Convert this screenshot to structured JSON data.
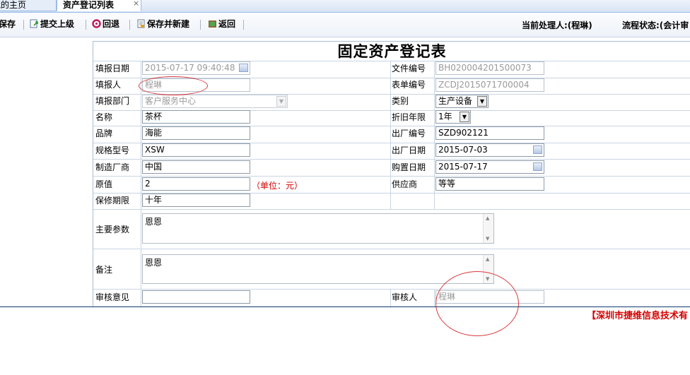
{
  "tabs": [
    {
      "label": "我的主页"
    },
    {
      "label": "资产登记列表",
      "close": "×"
    }
  ],
  "toolbar": {
    "save": "保存",
    "submit": "提交上级",
    "back": "回退",
    "save_new": "保存并新建",
    "return": "返回",
    "handler": "当前处理人:(程琳)",
    "status": "流程状态:(会计审"
  },
  "form": {
    "title": "固定资产登记表",
    "fill_date": {
      "label": "填报日期",
      "value": "2015-07-17 09:40:48"
    },
    "file_no": {
      "label": "文件编号",
      "value": "BH020004201500073"
    },
    "filler": {
      "label": "填报人",
      "value": "程琳"
    },
    "form_no": {
      "label": "表单编号",
      "value": "ZCDJ2015071700004"
    },
    "dept": {
      "label": "填报部门",
      "value": "客户服务中心"
    },
    "category": {
      "label": "类别",
      "value": "生产设备"
    },
    "name": {
      "label": "名称",
      "value": "茶杯"
    },
    "dep_years": {
      "label": "折旧年限",
      "value": "1年"
    },
    "brand": {
      "label": "品牌",
      "value": "海能"
    },
    "serial": {
      "label": "出厂编号",
      "value": "SZD902121"
    },
    "model": {
      "label": "规格型号",
      "value": "XSW"
    },
    "mfg_date": {
      "label": "出厂日期",
      "value": "2015-07-03"
    },
    "maker": {
      "label": "制造厂商",
      "value": "中国"
    },
    "buy_date": {
      "label": "购置日期",
      "value": "2015-07-17"
    },
    "orig_value": {
      "label": "原值",
      "value": "2",
      "unit": "（单位：元）"
    },
    "supplier": {
      "label": "供应商",
      "value": "等等"
    },
    "warranty": {
      "label": "保修期限",
      "value": "十年"
    },
    "params": {
      "label": "主要参数",
      "value": "恩恩"
    },
    "remark": {
      "label": "备注",
      "value": "恩恩"
    },
    "opinion": {
      "label": "审核意见",
      "value": ""
    },
    "reviewer": {
      "label": "审核人",
      "value": "程琳"
    }
  },
  "footer": "【深圳市捷维信息技术有",
  "colors": {
    "annotation": "#d9393d",
    "accent_red": "#d40000",
    "border": "#c9d5e4"
  }
}
